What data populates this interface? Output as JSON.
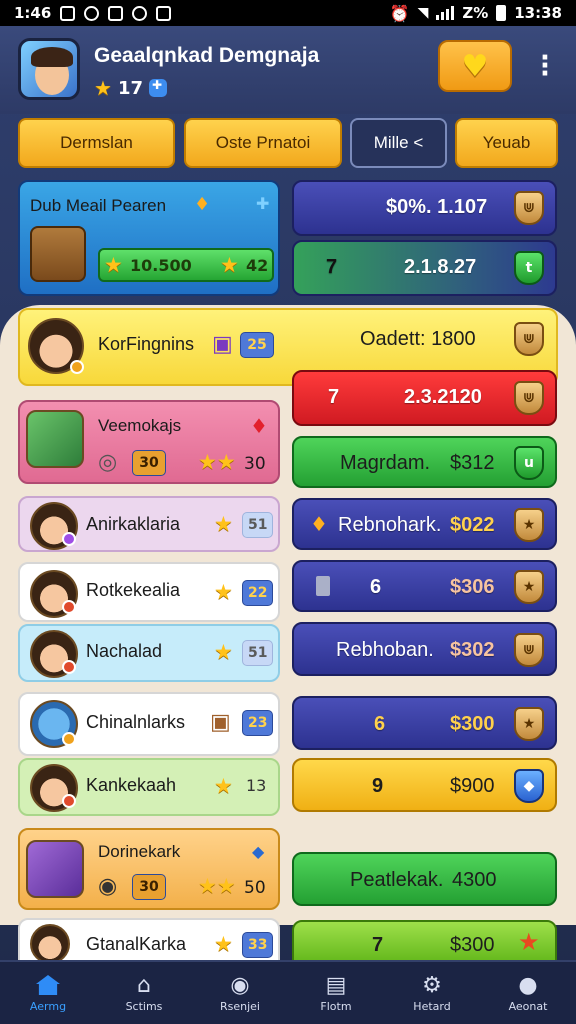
{
  "status_bar": {
    "time": "1:46",
    "battery": "Z%",
    "clock_right": "13:38"
  },
  "header": {
    "title": "Geaalqnkad Demgnaja",
    "level": "17",
    "menu_icon": "kebab-menu-icon",
    "gem_icon": "gem-heart-icon"
  },
  "tabs": [
    {
      "label": "Dermslan"
    },
    {
      "label": "Oste Prnatoi"
    },
    {
      "label": "Mille <"
    },
    {
      "label": "Yeuab"
    }
  ],
  "featured": {
    "name": "Dub Meail Pearen",
    "score": "10.500",
    "stars": "42"
  },
  "top_right": [
    {
      "amount": "$0%. 1.107"
    },
    {
      "prefix": "7",
      "amount": "2.1.8.27"
    }
  ],
  "highlight_row": {
    "name": "KorFingnins",
    "count": "25",
    "amount_label": "Oadett: 1800"
  },
  "red_row": {
    "prefix": "7",
    "amount": "2.3.2120"
  },
  "left_players": [
    {
      "name": "Veemokajs",
      "pill": "30",
      "score": "30"
    },
    {
      "name": "Anirkaklaria",
      "pill": "51"
    },
    {
      "name": "Rotkekealia",
      "pill": "22"
    },
    {
      "name": "Nachalad",
      "pill": "51"
    },
    {
      "name": "Chinalnlarks",
      "pill": "23"
    },
    {
      "name": "Kankekaah",
      "pill": "13"
    },
    {
      "name": "Dorinekark",
      "pill": "30",
      "score": "50"
    },
    {
      "name": "GtanalKarka",
      "pill": "33"
    }
  ],
  "right_rewards": [
    {
      "label": "Magrdam.",
      "amount": "$312"
    },
    {
      "label": "Rebnohark.",
      "amount": "$022"
    },
    {
      "prefix": "6",
      "amount": "$306"
    },
    {
      "label": "Rebhoban.",
      "amount": "$302"
    },
    {
      "prefix": "6",
      "amount": "$300"
    },
    {
      "prefix": "9",
      "amount": "$900"
    },
    {
      "label": "Peatlekak.",
      "amount": "4300"
    },
    {
      "prefix": "7",
      "amount": "$300"
    }
  ],
  "bottom_nav": [
    {
      "label": "Aermg",
      "icon": "home-icon"
    },
    {
      "label": "Sctims",
      "icon": "house-outline-icon"
    },
    {
      "label": "Rsenjei",
      "icon": "coin-icon"
    },
    {
      "label": "Flotm",
      "icon": "bag-icon"
    },
    {
      "label": "Hetard",
      "icon": "gear-icon"
    },
    {
      "label": "Aeonat",
      "icon": "person-icon"
    }
  ],
  "colors": {
    "background": "#2a3660",
    "gold_button": "#f2a81c",
    "green": "#2fbf3f",
    "red": "#e0252a",
    "blue_panel": "#3a3fa0",
    "active_nav": "#3aa0ff"
  }
}
